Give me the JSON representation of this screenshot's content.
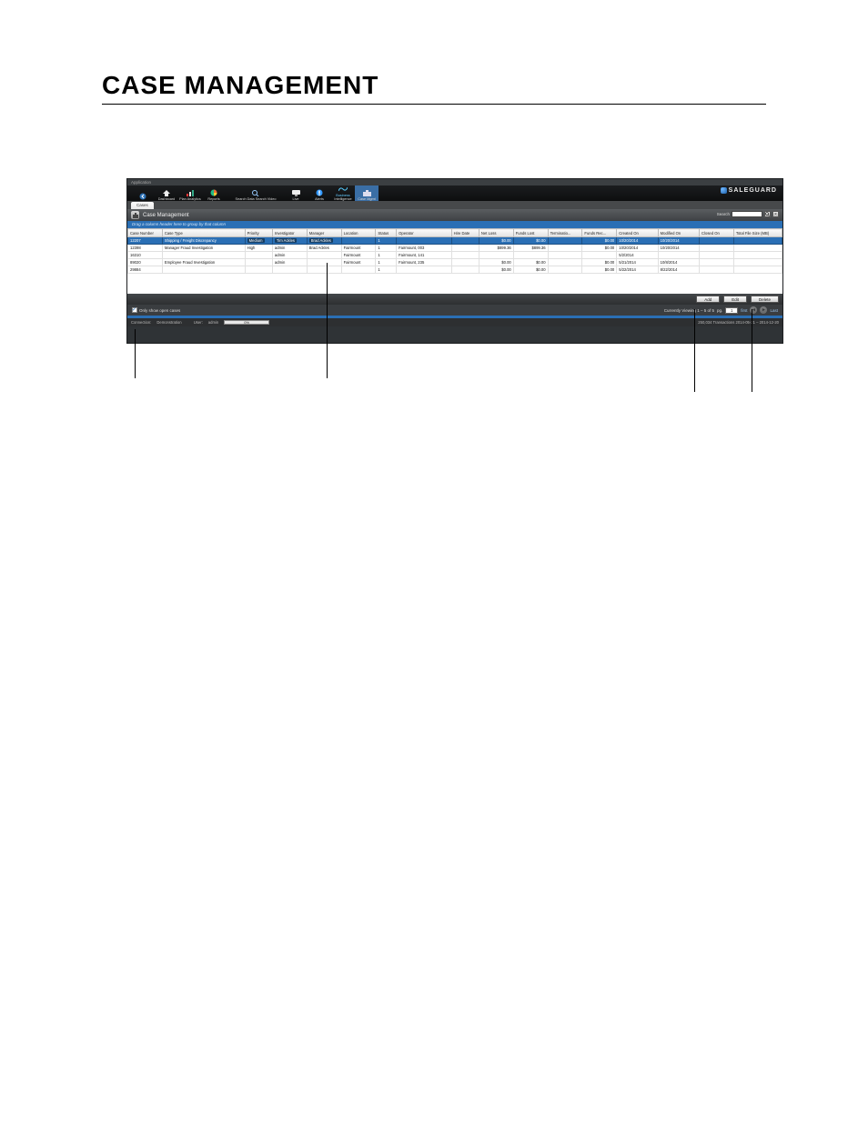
{
  "doc": {
    "title": "CASE MANAGEMENT"
  },
  "app_label": "Application",
  "brand": "SALEGUARD",
  "toolbar": {
    "back_label": "",
    "items": [
      {
        "label": "Dashboard"
      },
      {
        "label": "Plan Analytics"
      },
      {
        "label": "Reports"
      },
      {
        "label": ""
      },
      {
        "label": "Search Data Search Video"
      },
      {
        "label": ""
      },
      {
        "label": "Live"
      },
      {
        "label": "Alerts"
      },
      {
        "label": "Intelligence",
        "sup": "Business"
      },
      {
        "label": "Case Mgmt"
      }
    ]
  },
  "tab": "Cases",
  "panel": {
    "title": "Case Management"
  },
  "search": {
    "label": "Search",
    "value": ""
  },
  "grouping_hint": "Drag a column header here to group by that column",
  "columns": [
    "Case Number",
    "Case Type",
    "Priority",
    "Investigator",
    "Manager",
    "Location",
    "Status",
    "Operator",
    "Hire Date",
    "Net Loss",
    "Funds Lost",
    "Terminatio...",
    "Funds Rec...",
    "Created On",
    "Modified On",
    "Closed On",
    "Total File Size (MB)"
  ],
  "rows": [
    {
      "case_number": "12207",
      "case_type": "Shipping / Freight Discrepancy",
      "priority": "Medium",
      "investigator": "Tim Ackles",
      "manager": "Brad Ackles",
      "location": "",
      "status": "1",
      "operator": "",
      "hire_date": "",
      "net_loss": "$0.00",
      "funds_lost": "$0.00",
      "termination": "",
      "funds_rec": "$0.00",
      "created_on": "10/20/2014",
      "modified_on": "10/20/2014",
      "closed_on": "",
      "file_size": "",
      "selected": true
    },
    {
      "case_number": "12398",
      "case_type": "Manager Fraud Investigation",
      "priority": "High",
      "investigator": "admin",
      "manager": "Brad Ackles",
      "location": "Fairmount",
      "status": "1",
      "operator": "Fairmount, 003",
      "hire_date": "",
      "net_loss": "$899.36",
      "funds_lost": "$899.36",
      "termination": "",
      "funds_rec": "$0.00",
      "created_on": "10/20/2014",
      "modified_on": "10/20/2014",
      "closed_on": "",
      "file_size": ""
    },
    {
      "case_number": "16310",
      "case_type": "",
      "priority": "",
      "investigator": "admin",
      "manager": "",
      "location": "Fairmount",
      "status": "1",
      "operator": "Fairmount, 141",
      "hire_date": "",
      "net_loss": "",
      "funds_lost": "",
      "termination": "",
      "funds_rec": "",
      "created_on": "5/2/2014",
      "modified_on": "",
      "closed_on": "",
      "file_size": ""
    },
    {
      "case_number": "89020",
      "case_type": "Employee Fraud Investigation",
      "priority": "",
      "investigator": "admin",
      "manager": "",
      "location": "Fairmount",
      "status": "1",
      "operator": "Fairmount, 235",
      "hire_date": "",
      "net_loss": "$0.00",
      "funds_lost": "$0.00",
      "termination": "",
      "funds_rec": "$0.00",
      "created_on": "5/21/2014",
      "modified_on": "10/8/2014",
      "closed_on": "",
      "file_size": ""
    },
    {
      "case_number": "29884",
      "case_type": "",
      "priority": "",
      "investigator": "",
      "manager": "",
      "location": "",
      "status": "1",
      "operator": "",
      "hire_date": "",
      "net_loss": "$0.00",
      "funds_lost": "$0.00",
      "termination": "",
      "funds_rec": "$0.00",
      "created_on": "5/22/2014",
      "modified_on": "8/22/2014",
      "closed_on": "",
      "file_size": ""
    }
  ],
  "actions": {
    "add": "Add",
    "edit": "Edit",
    "delete": "Delete"
  },
  "open_cases_label": "Only show open cases",
  "pager": {
    "summary": "Currently Viewing 1 – 5 of 5",
    "page": "pg.",
    "page_value": "1",
    "first": "first",
    "last": "Last"
  },
  "status": {
    "connection_label": "Connection:",
    "connection_value": "Demonstration",
    "user_label": "User:",
    "user_value": "admin",
    "progress_pct": "0%",
    "right": "250,034 Transactions 2014-05-21 – 2014-12-20"
  }
}
